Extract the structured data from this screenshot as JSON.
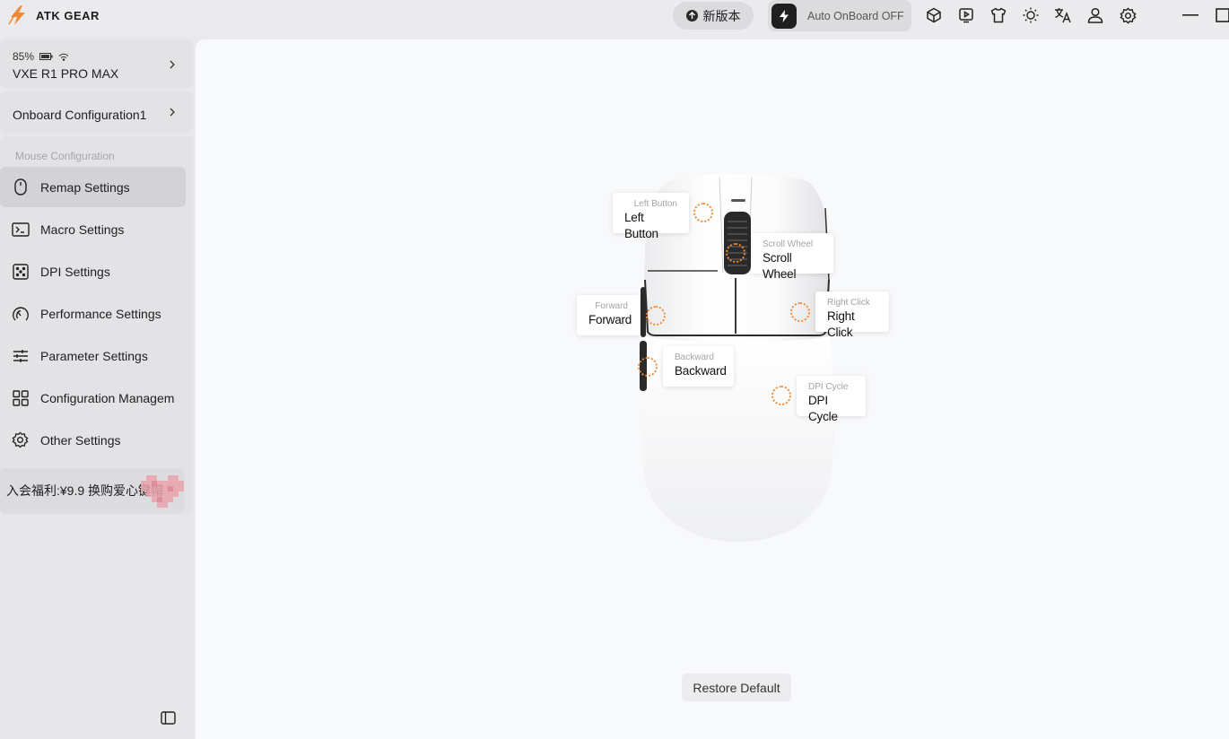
{
  "app": {
    "brand": "ATK GEAR"
  },
  "topbar": {
    "new_version_label": "新版本",
    "auto_onboard_label": "Auto OnBoard OFF",
    "icons": [
      "cube-icon",
      "video-guide-icon",
      "shirt-icon",
      "brightness-icon",
      "translate-icon",
      "account-icon",
      "settings-icon",
      "minimize-icon",
      "maximize-icon"
    ]
  },
  "device": {
    "battery": "85%",
    "name": "VXE R1 PRO MAX"
  },
  "onboard": {
    "name": "Onboard Configuration1"
  },
  "sidebar": {
    "section_title": "Mouse Configuration",
    "items": [
      {
        "label": "Remap Settings",
        "icon": "mouse-icon",
        "active": true
      },
      {
        "label": "Macro Settings",
        "icon": "terminal-icon",
        "active": false
      },
      {
        "label": "DPI Settings",
        "icon": "dice-icon",
        "active": false
      },
      {
        "label": "Performance Settings",
        "icon": "gauge-icon",
        "active": false
      },
      {
        "label": "Parameter Settings",
        "icon": "sliders-icon",
        "active": false
      },
      {
        "label": "Configuration Managem",
        "icon": "grid-icon",
        "active": false
      },
      {
        "label": "Other Settings",
        "icon": "gear-icon",
        "active": false
      }
    ],
    "promo_text": "入会福利:¥9.9 换购爱心键帽"
  },
  "buttons": [
    {
      "title": "Left Button",
      "value": "Left Button"
    },
    {
      "title": "Scroll Wheel",
      "value": "Scroll Wheel"
    },
    {
      "title": "Forward",
      "value": "Forward"
    },
    {
      "title": "Right Click",
      "value": "Right Click"
    },
    {
      "title": "Backward",
      "value": "Backward"
    },
    {
      "title": "DPI Cycle",
      "value": "DPI Cycle"
    }
  ],
  "restore_label": "Restore Default",
  "colors": {
    "accent": "#f08a35",
    "active_item": "#d3d3d7",
    "panel": "#f8f9fb"
  }
}
